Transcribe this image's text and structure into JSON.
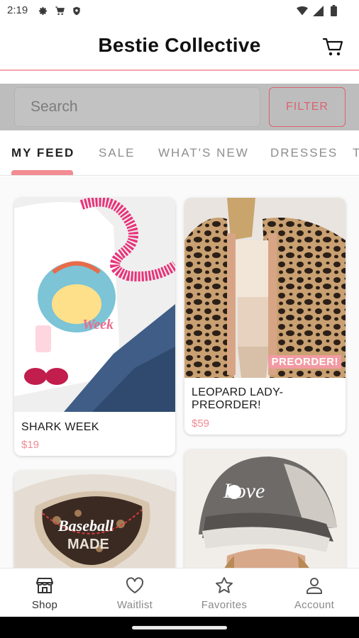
{
  "status_bar": {
    "time": "2:19",
    "left_icons": [
      "gear-icon",
      "cart-icon",
      "shield-icon"
    ],
    "right_icons": [
      "wifi-icon",
      "signal-icon",
      "battery-icon"
    ]
  },
  "header": {
    "title": "Bestie Collective",
    "cart_icon": "cart-icon"
  },
  "search": {
    "placeholder": "Search",
    "filter_label": "FILTER"
  },
  "tabs": [
    {
      "label": "MY FEED",
      "active": true
    },
    {
      "label": "SALE",
      "active": false
    },
    {
      "label": "WHAT'S NEW",
      "active": false
    },
    {
      "label": "DRESSES",
      "active": false
    },
    {
      "label": "T",
      "active": false
    }
  ],
  "products": [
    {
      "name": "SHARK WEEK",
      "price": "$19",
      "badge": "",
      "image_desc": "white shark week tee with jeans and pink tinsel"
    },
    {
      "name": "LEOPARD LADY-PREORDER!",
      "price": "$59",
      "badge": "PREORDER!",
      "image_desc": "leopard print sherpa jacket"
    },
    {
      "name": "",
      "price": "",
      "badge": "",
      "image_desc": "baseball mama distressed cap"
    },
    {
      "name": "",
      "price": "",
      "badge": "",
      "image_desc": "gray love trucker hat"
    }
  ],
  "bottom_nav": [
    {
      "label": "Shop",
      "icon": "store-icon",
      "active": true
    },
    {
      "label": "Waitlist",
      "icon": "heart-icon",
      "active": false
    },
    {
      "label": "Favorites",
      "icon": "star-icon",
      "active": false
    },
    {
      "label": "Account",
      "icon": "person-icon",
      "active": false
    }
  ],
  "colors": {
    "accent": "#f28b92",
    "filter_border": "#d9636f",
    "price": "#ef8a92"
  }
}
